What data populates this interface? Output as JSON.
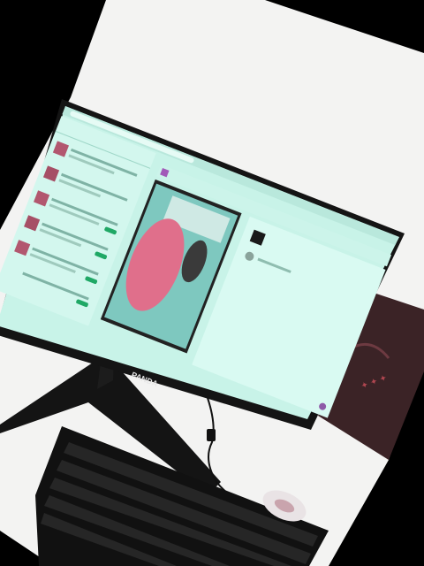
{
  "monitor": {
    "brand_label": "PANDA"
  },
  "colors": {
    "backdrop": "#000000",
    "desk": "#f4f4f4",
    "screen_tint": "#c8f3e8",
    "bezel": "#141414",
    "wig_pink": "#e06f8b",
    "bag": "#3b2326",
    "keyboard": "#111111"
  }
}
